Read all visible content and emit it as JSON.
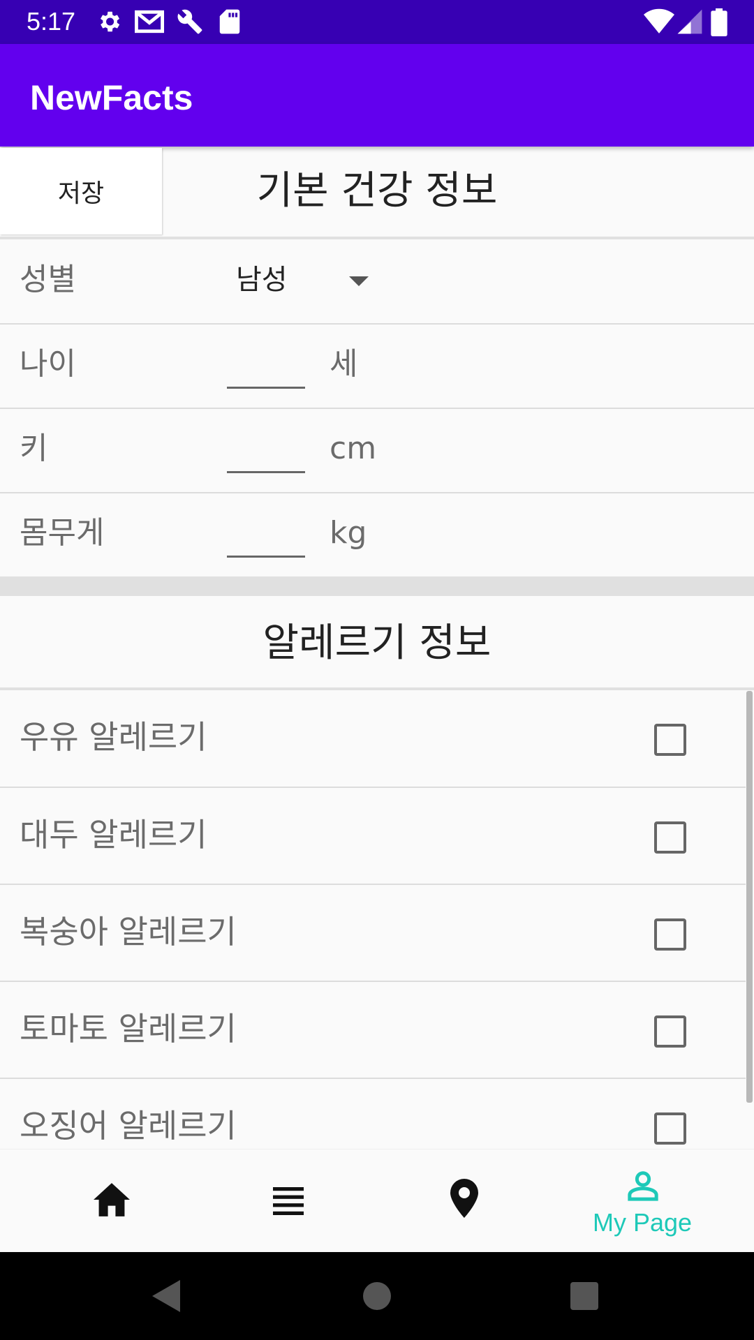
{
  "status_bar": {
    "time": "5:17",
    "icons_left": [
      "gear-icon",
      "gmail-icon",
      "wrench-icon",
      "sd-card-icon"
    ],
    "icons_right": [
      "wifi-icon",
      "signal-icon",
      "battery-icon"
    ]
  },
  "app_bar": {
    "title": "NewFacts"
  },
  "basic_info": {
    "save_label": "저장",
    "title": "기본 건강 정보",
    "gender": {
      "label": "성별",
      "value": "남성"
    },
    "age": {
      "label": "나이",
      "value": "",
      "unit": "세"
    },
    "height": {
      "label": "키",
      "value": "",
      "unit": "cm"
    },
    "weight": {
      "label": "몸무게",
      "value": "",
      "unit": "kg"
    }
  },
  "allergy": {
    "title": "알레르기 정보",
    "items": [
      {
        "label": "우유 알레르기",
        "checked": false
      },
      {
        "label": "대두 알레르기",
        "checked": false
      },
      {
        "label": "복숭아 알레르기",
        "checked": false
      },
      {
        "label": "토마토 알레르기",
        "checked": false
      },
      {
        "label": "오징어 알레르기",
        "checked": false
      }
    ]
  },
  "bottom_nav": {
    "items": [
      {
        "icon": "home-icon",
        "label": ""
      },
      {
        "icon": "list-icon",
        "label": ""
      },
      {
        "icon": "location-pin-icon",
        "label": ""
      },
      {
        "icon": "person-icon",
        "label": "My Page",
        "active": true
      }
    ],
    "active_color": "#1ec9b8"
  },
  "colors": {
    "status_bar": "#3700b3",
    "app_bar": "#6200ee"
  }
}
